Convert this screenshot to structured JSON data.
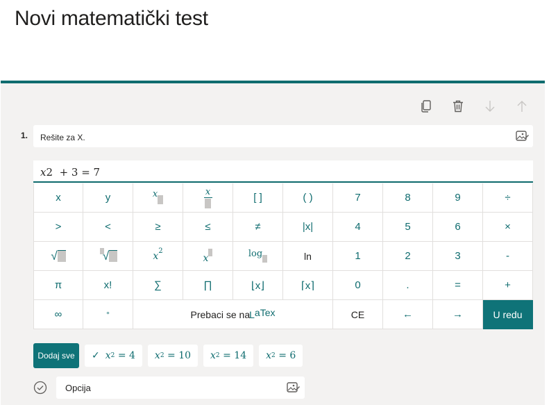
{
  "page": {
    "title": "Novi matematički test"
  },
  "toolbar": {
    "icons": [
      "copy-icon",
      "trash-icon",
      "arrow-down-icon",
      "arrow-up-icon"
    ]
  },
  "question": {
    "number": "1.",
    "text": "Rešite za X.",
    "equation": {
      "var": "x",
      "exp": "2",
      "rest": "+ 3 = 7"
    }
  },
  "keypad": {
    "row1": [
      "x",
      "y",
      "x",
      "x",
      "[ ]",
      "( )",
      "7",
      "8",
      "9",
      "÷"
    ],
    "row2": [
      ">",
      "<",
      "≥",
      "≤",
      "≠",
      "|x|",
      "4",
      "5",
      "6",
      "×"
    ],
    "row3": [
      "√",
      "√",
      "x",
      "2",
      "x",
      "log",
      "ln",
      "1",
      "2",
      "3",
      "-"
    ],
    "row4": [
      "π",
      "x!",
      "∑",
      "∏",
      "⌊x⌋",
      "⌈x⌉",
      "0",
      ".",
      "=",
      "+"
    ],
    "row5": {
      "infinity": "∞",
      "degree": "°",
      "latex_prefix": "Prebaci se na ",
      "latex_l": "L",
      "latex_rest": "aTex",
      "ce": "CE",
      "left": "←",
      "right": "→",
      "ok": "U redu"
    }
  },
  "suggestions": {
    "add_all": "Dodaj sve",
    "check": "✓",
    "items": [
      {
        "var": "x",
        "sub": "2",
        "rest": "= 4"
      },
      {
        "var": "x",
        "sub": "2",
        "rest": "= 10"
      },
      {
        "var": "x",
        "sub": "2",
        "rest": "= 14"
      },
      {
        "var": "x",
        "sub": "2",
        "rest": "= 6"
      }
    ]
  },
  "option": {
    "text": "Opcija"
  },
  "colors": {
    "accent": "#0f6c6f",
    "button": "#0f7378",
    "card_bg": "#f3f2f1"
  }
}
